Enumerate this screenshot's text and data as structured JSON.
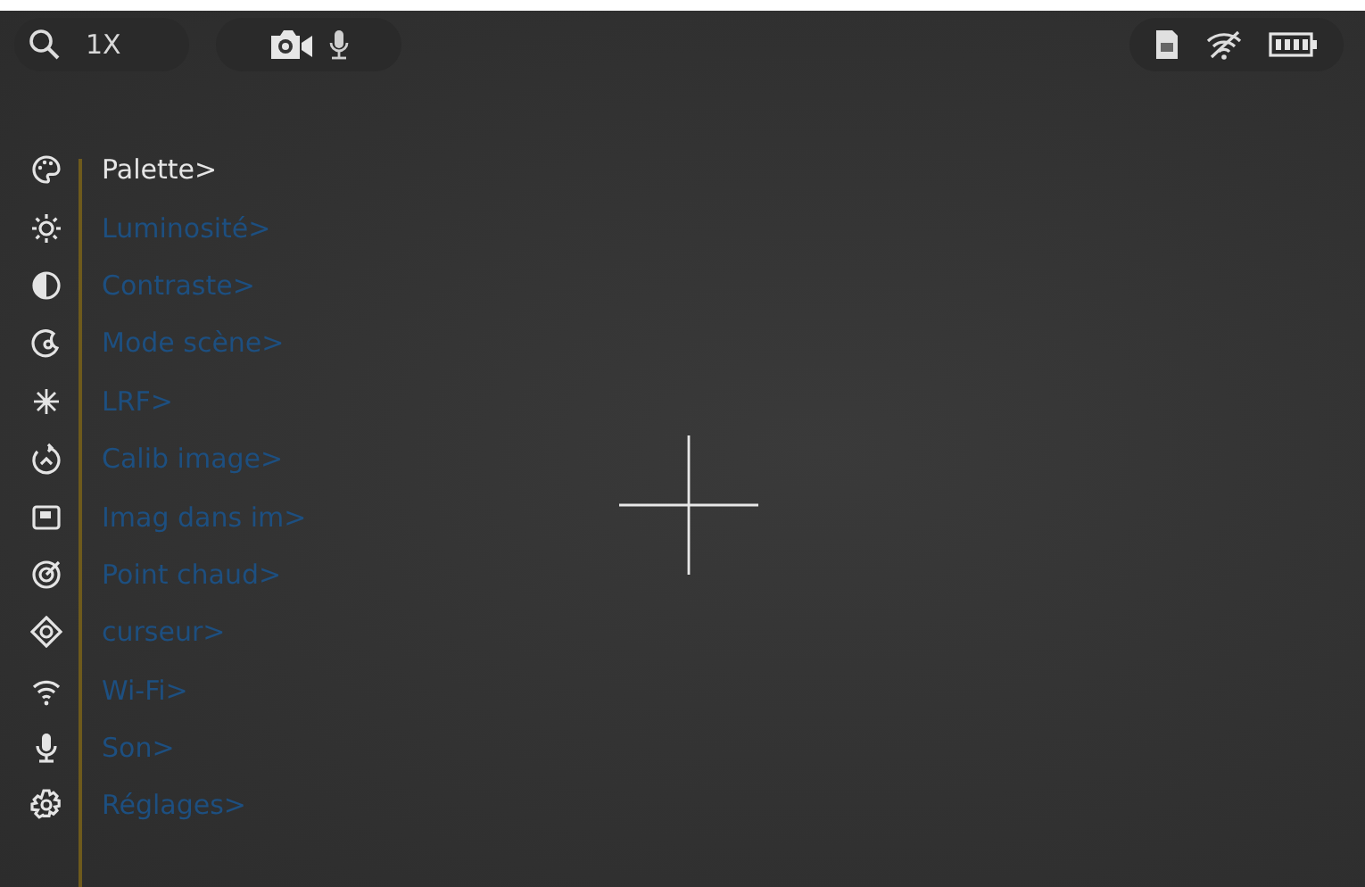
{
  "zoom": {
    "label": "1X"
  },
  "menu": {
    "items": [
      {
        "label": "Palette>",
        "selected": true
      },
      {
        "label": "Luminosité>",
        "selected": false
      },
      {
        "label": "Contraste>",
        "selected": false
      },
      {
        "label": "Mode scène>",
        "selected": false
      },
      {
        "label": "LRF>",
        "selected": false
      },
      {
        "label": "Calib image>",
        "selected": false
      },
      {
        "label": "Imag dans im>",
        "selected": false
      },
      {
        "label": "Point chaud>",
        "selected": false
      },
      {
        "label": "curseur>",
        "selected": false
      },
      {
        "label": "Wi-Fi>",
        "selected": false
      },
      {
        "label": "Son>",
        "selected": false
      },
      {
        "label": "Réglages>",
        "selected": false
      }
    ]
  }
}
